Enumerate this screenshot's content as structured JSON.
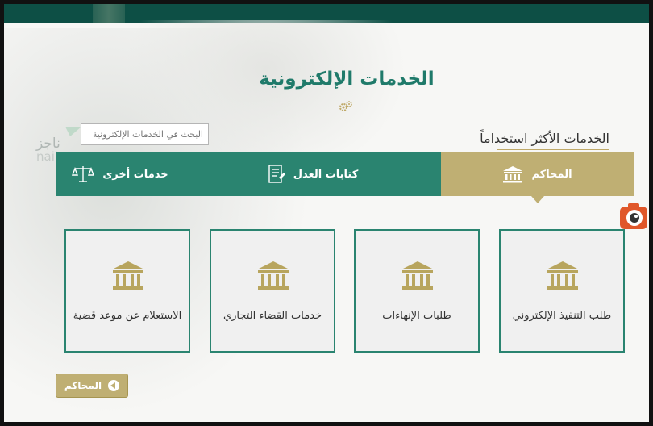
{
  "page": {
    "title": "الخدمات الإلكترونية",
    "search_placeholder": "البحث في الخدمات الإلكترونية",
    "section_title": "الخدمات الأكثر استخداماً",
    "logo_text": "ناجز"
  },
  "tabs": [
    {
      "label": "المحاكم",
      "icon": "court-building-icon",
      "active": true
    },
    {
      "label": "كتابات العدل",
      "icon": "document-icon",
      "active": false
    },
    {
      "label": "خدمات أخرى",
      "icon": "scales-icon",
      "active": false
    }
  ],
  "cards": [
    {
      "label": "طلب التنفيذ الإلكتروني",
      "icon": "court-building-icon"
    },
    {
      "label": "طلبات الإنهاءات",
      "icon": "court-building-icon"
    },
    {
      "label": "خدمات القضاء التجاري",
      "icon": "court-building-icon"
    },
    {
      "label": "الاستعلام عن موعد قضية",
      "icon": "court-building-icon"
    }
  ],
  "back_button": {
    "label": "المحاكم",
    "icon": "arrow-left-icon"
  },
  "colors": {
    "primary_green": "#2a8470",
    "dark_green": "#0d4f45",
    "gold": "#bfaf73",
    "title_green": "#1f7a6a"
  }
}
